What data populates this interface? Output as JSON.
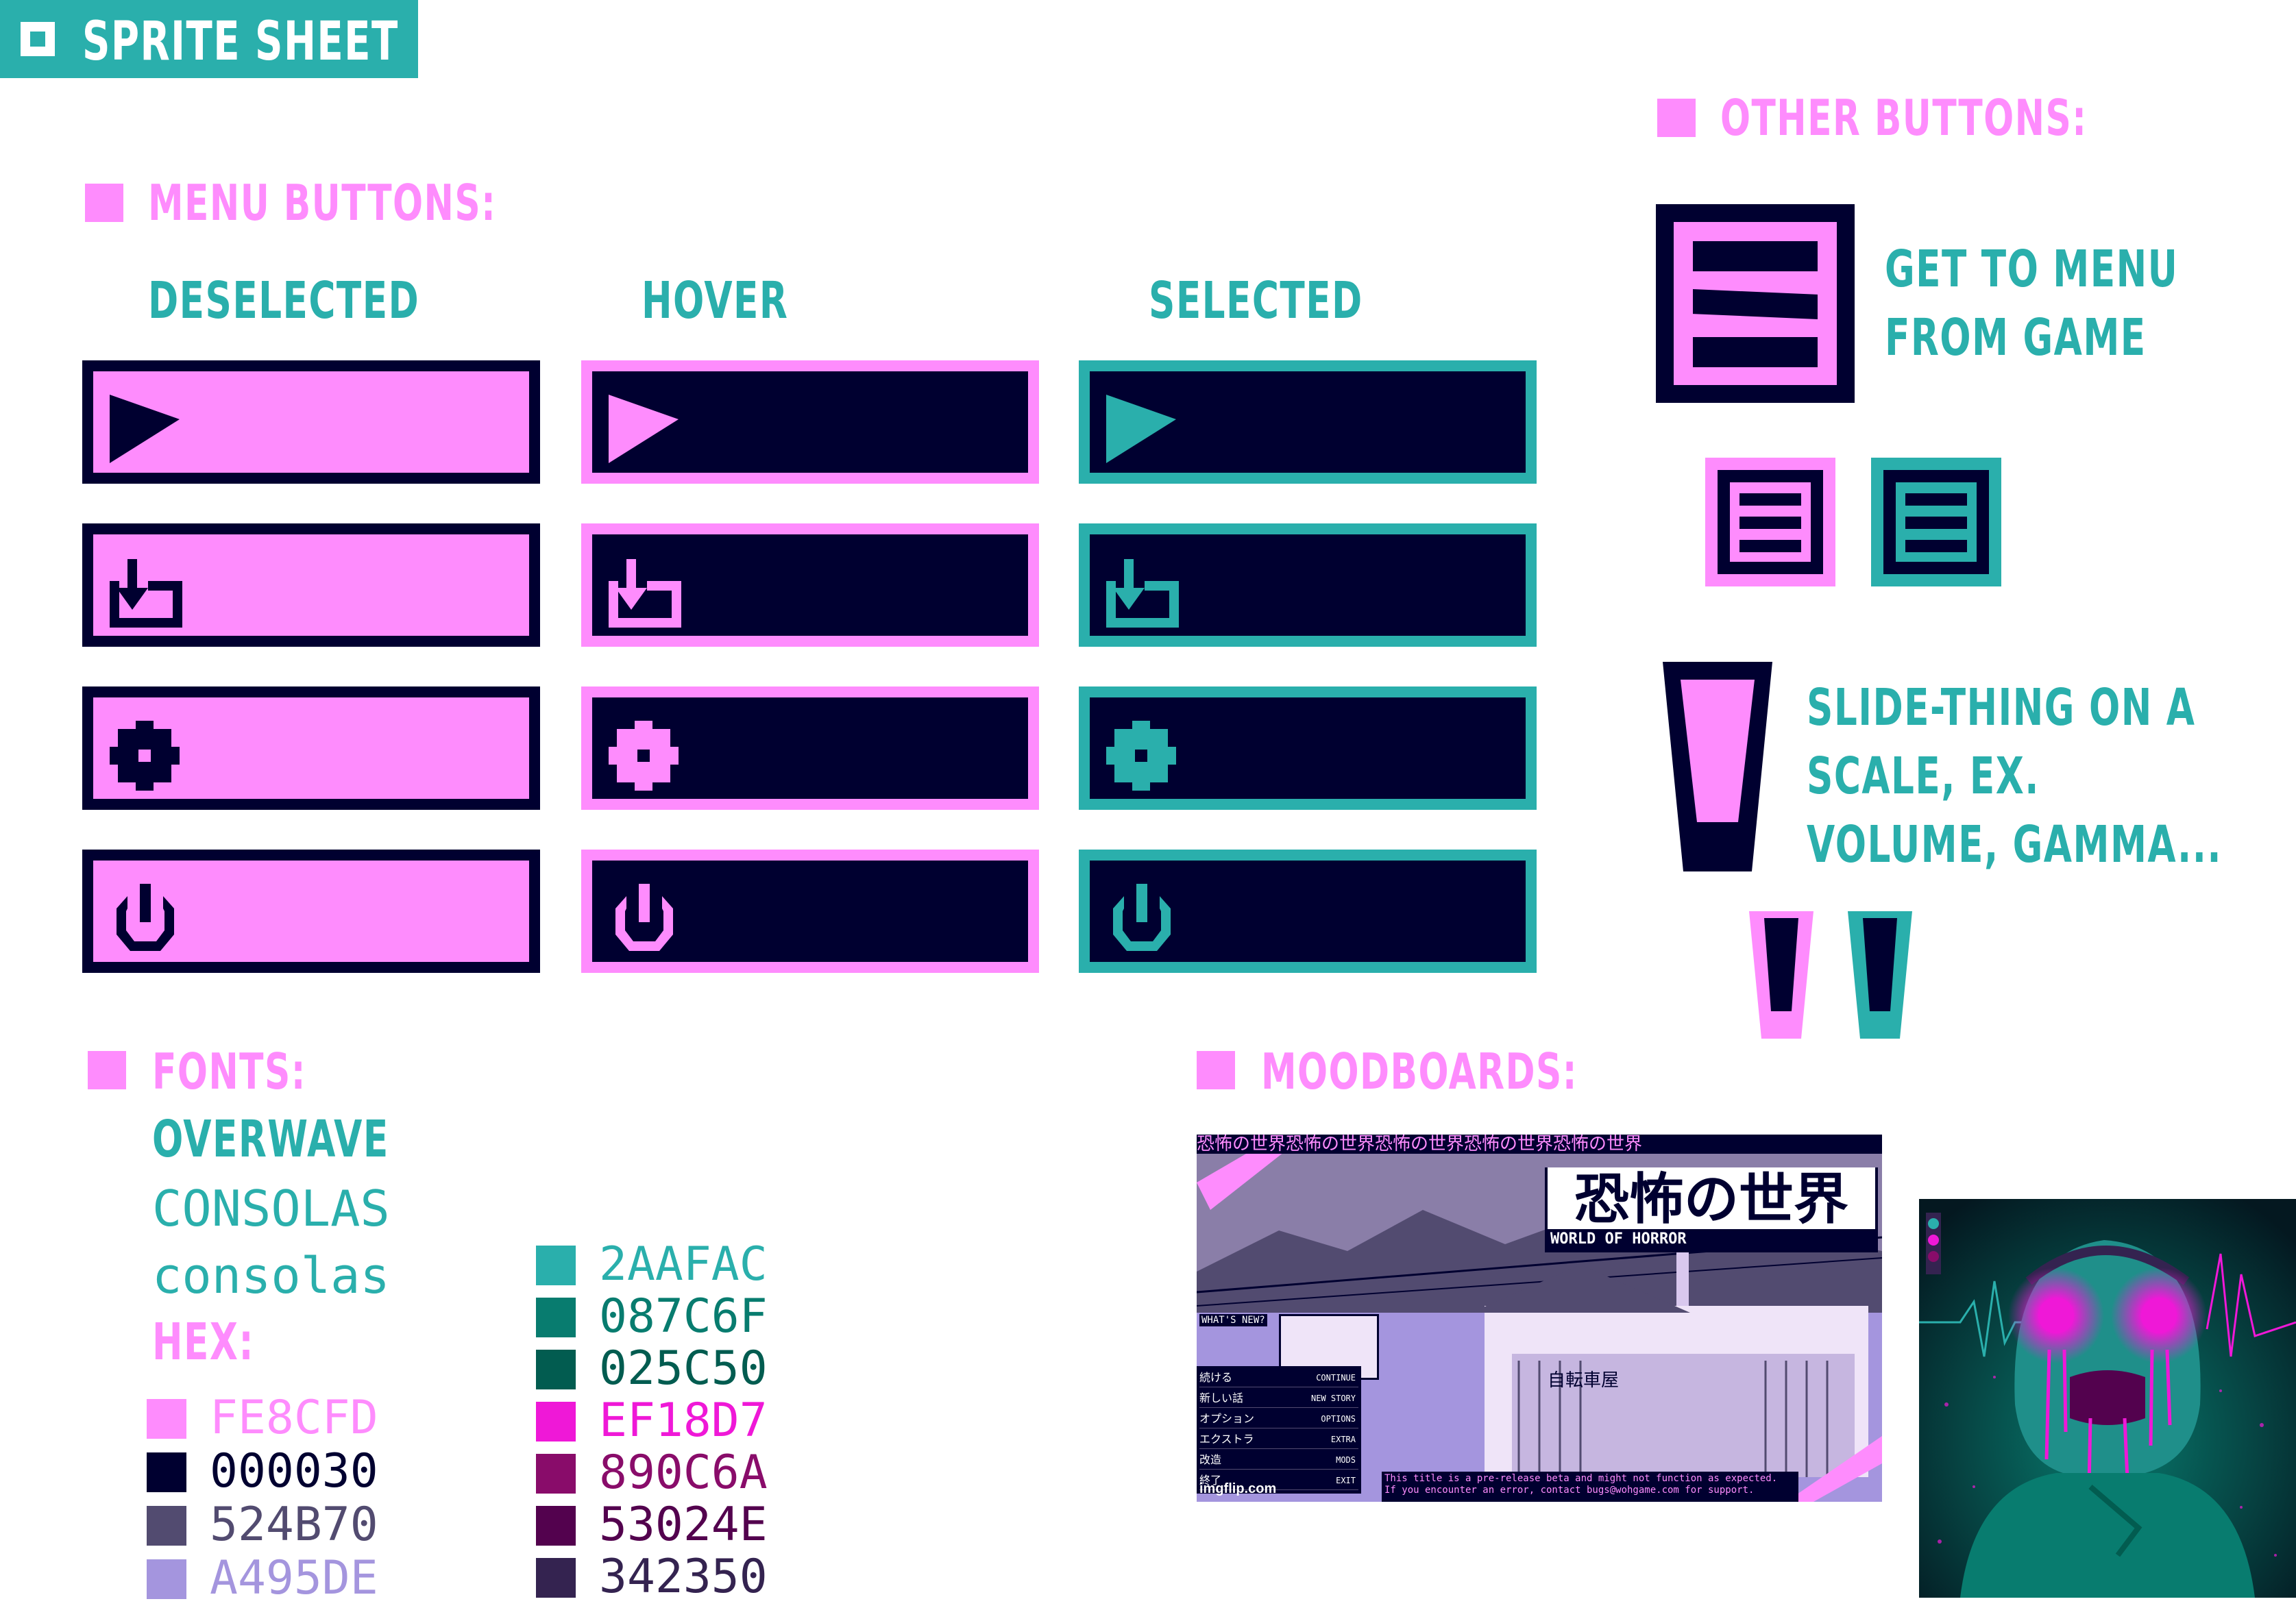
{
  "colors": {
    "pink": "#FE8CFD",
    "navy": "#000030",
    "teal": "#2AAFAC",
    "teal_header": "#2AAFAC"
  },
  "header": {
    "title": "SPRITE SHEET",
    "icon": "square-icon"
  },
  "menu_buttons": {
    "heading": "MENU BUTTONS:",
    "columns": [
      {
        "label": "DESELECTED",
        "state": "deselected"
      },
      {
        "label": "HOVER",
        "state": "hover"
      },
      {
        "label": "SELECTED",
        "state": "selected"
      }
    ],
    "rows": [
      {
        "icon": "play-icon"
      },
      {
        "icon": "download-icon"
      },
      {
        "icon": "gear-icon"
      },
      {
        "icon": "power-icon"
      }
    ]
  },
  "other_buttons": {
    "heading": "OTHER BUTTONS:",
    "menu_button_caption_1": "GET TO MENU",
    "menu_button_caption_2": "FROM GAME",
    "menu_button_icon": "hamburger-menu-icon",
    "slider_caption_1": "SLIDE-THING ON A",
    "slider_caption_2": "SCALE, EX.",
    "slider_caption_3": "VOLUME, GAMMA...",
    "slider_icon": "slider-handle-icon"
  },
  "fonts": {
    "heading": "FONTS:",
    "items": [
      "OVERWAVE",
      "CONSOLAS",
      "consolas"
    ]
  },
  "hex": {
    "heading": "HEX:",
    "left": [
      {
        "color": "#FE8CFD",
        "label": "FE8CFD"
      },
      {
        "color": "#000030",
        "label": "000030"
      },
      {
        "color": "#524B70",
        "label": "524B70"
      },
      {
        "color": "#A495DE",
        "label": "A495DE"
      }
    ],
    "right": [
      {
        "color": "#2AAFAC",
        "label": "2AAFAC"
      },
      {
        "color": "#087C6F",
        "label": "087C6F"
      },
      {
        "color": "#025C50",
        "label": "025C50"
      },
      {
        "color": "#EF18D7",
        "label": "EF18D7"
      },
      {
        "color": "#890C6A",
        "label": "890C6A"
      },
      {
        "color": "#53024E",
        "label": "53024E"
      },
      {
        "color": "#342350",
        "label": "342350"
      }
    ]
  },
  "moodboards": {
    "heading": "MOODBOARDS:",
    "image1": {
      "title_jp": "恐怖の世界",
      "title_en": "WORLD OF HORROR",
      "banner_jp": "恐怖の世界恐怖の世界恐怖の世界恐怖の世界恐怖の世界",
      "whats_new": "WHAT'S NEW?",
      "shop_sign": "自転車屋",
      "menu": [
        {
          "jp": "続ける",
          "en": "CONTINUE"
        },
        {
          "jp": "新しい話",
          "en": "NEW STORY"
        },
        {
          "jp": "オプション",
          "en": "OPTIONS"
        },
        {
          "jp": "エクストラ",
          "en": "EXTRA"
        },
        {
          "jp": "改造",
          "en": "MODS"
        },
        {
          "jp": "終了",
          "en": "EXIT"
        }
      ],
      "notice_1": "This title is a pre-release beta and might not function as expected.",
      "notice_2": "If you encounter an error, contact bugs@wohgame.com for support.",
      "watermark": "imgflip.com"
    },
    "image2": {
      "subject": "glowing-eyes-figure"
    }
  }
}
